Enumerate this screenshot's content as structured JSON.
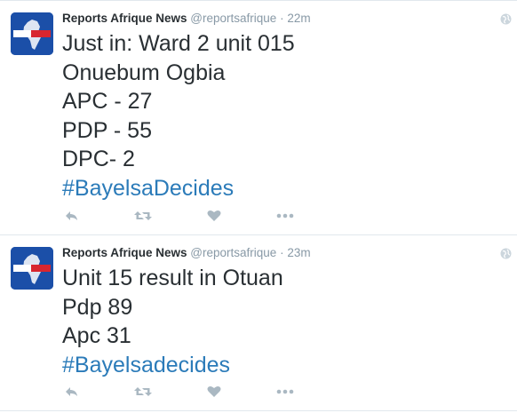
{
  "tweets": [
    {
      "avatar_logo": "REPORTS AFRIQUE",
      "author_name": "Reports Afrique News",
      "handle": "@reportsafrique",
      "separator": "·",
      "time": "22m",
      "lines": [
        "Just in: Ward 2 unit 015",
        "Onuebum Ogbia",
        "APC - 27",
        "PDP - 55",
        "DPC- 2"
      ],
      "hashtag": "#BayelsaDecides"
    },
    {
      "avatar_logo": "REPORTS AFRIQUE",
      "author_name": "Reports Afrique News",
      "handle": "@reportsafrique",
      "separator": "·",
      "time": "23m",
      "lines": [
        "Unit 15 result in Otuan",
        "Pdp 89",
        "Apc 31"
      ],
      "hashtag": "#Bayelsadecides"
    }
  ],
  "icons": {
    "globe": "globe-icon",
    "reply": "reply-icon",
    "retweet": "retweet-icon",
    "like": "heart-icon",
    "more": "more-icon"
  },
  "colors": {
    "text": "#292f33",
    "muted": "#8899a6",
    "hashtag": "#2b7bb9",
    "action_icon": "#aab8c2",
    "avatar_bg": "#1b4fa8",
    "logo_red": "#d8262f"
  }
}
